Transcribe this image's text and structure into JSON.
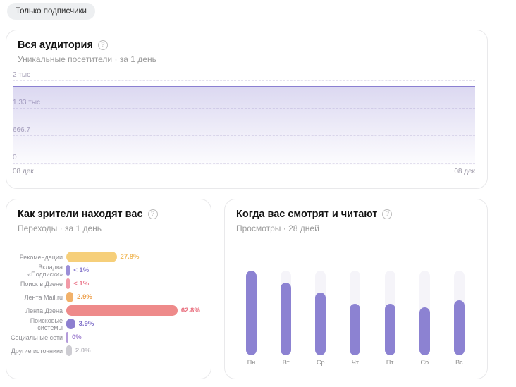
{
  "filter_chip": {
    "label": "Только подписчики"
  },
  "cards": {
    "audience": {
      "title": "Вся аудитория",
      "subtitle": "Уникальные посетители · за 1 день",
      "help_icon": "question-circle-icon"
    },
    "sources": {
      "title": "Как зрители находят вас",
      "subtitle": "Переходы · за 1 день",
      "help_icon": "question-circle-icon"
    },
    "schedule": {
      "title": "Когда вас смотрят и читают",
      "subtitle": "Просмотры · 28 дней",
      "help_icon": "question-circle-icon"
    }
  },
  "chart_data": [
    {
      "type": "area",
      "title": "Вся аудитория",
      "subtitle": "Уникальные посетители · за 1 день",
      "x_labels": [
        "08 дек",
        "08 дек"
      ],
      "values": [
        1860,
        1860
      ],
      "ylim": [
        0,
        2000
      ],
      "yticks": [
        "2 тыс",
        "1.33 тыс",
        "666.7",
        "0"
      ],
      "grid": "dashed",
      "line_color": "#8b80d1",
      "fill": "lavender-gradient"
    },
    {
      "type": "bar",
      "orientation": "horizontal",
      "title": "Как зрители находят вас",
      "subtitle": "Переходы · за 1 день",
      "categories": [
        "Рекомендации",
        "Вкладка «Подписки»",
        "Поиск в Дзене",
        "Лента Mail.ru",
        "Лента Дзена",
        "Поисковые системы",
        "Социальные сети",
        "Другие источники"
      ],
      "values": [
        27.8,
        0.9,
        0.9,
        2.9,
        62.8,
        3.9,
        0,
        2.0
      ],
      "value_labels": [
        "27.8%",
        "< 1%",
        "< 1%",
        "2.9%",
        "62.8%",
        "3.9%",
        "0%",
        "2.0%"
      ],
      "bar_colors": [
        "#f6cf7a",
        "#9b8ed8",
        "#f29aa7",
        "#f2b169",
        "#ee8a8a",
        "#8d7fd0",
        "#b49bda",
        "#cdccd2"
      ],
      "label_colors": [
        "#f0b95c",
        "#8d7fd0",
        "#ec7f92",
        "#eda04e",
        "#e9707f",
        "#7e6fc9",
        "#9f7fd0",
        "#b9b8bf"
      ],
      "xlim": [
        0,
        62.8
      ]
    },
    {
      "type": "bar",
      "orientation": "vertical",
      "title": "Когда вас смотрят и читают",
      "subtitle": "Просмотры · 28 дней",
      "categories": [
        "Пн",
        "Вт",
        "Ср",
        "Чт",
        "Пт",
        "Сб",
        "Вс"
      ],
      "values_pct_of_max": [
        100,
        86,
        74,
        61,
        61,
        57,
        65
      ],
      "bar_color": "#8c82d2",
      "track_color": "#f5f4f9"
    }
  ]
}
